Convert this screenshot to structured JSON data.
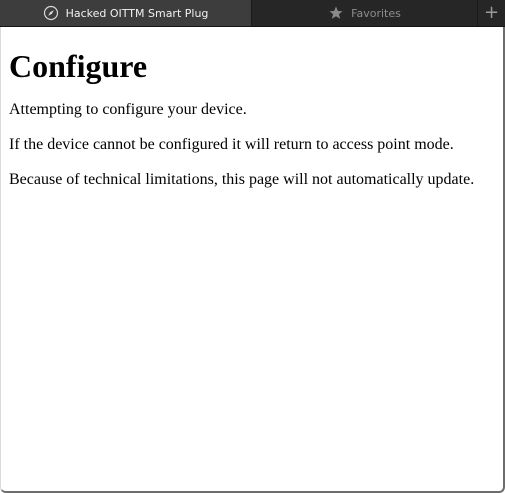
{
  "browser": {
    "tabs": [
      {
        "title": "Hacked OITTM Smart Plug",
        "icon": "compass-icon",
        "active": true
      },
      {
        "title": "Favorites",
        "icon": "star-icon",
        "active": false
      }
    ],
    "new_tab_label": "+"
  },
  "page": {
    "heading": "Configure",
    "paragraphs": [
      "Attempting to configure your device.",
      "If the device cannot be configured it will return to access point mode.",
      "Because of technical limitations, this page will not automatically update."
    ]
  },
  "colors": {
    "tabbar_background": "#2b2b2b",
    "active_tab_background": "#3d3d3d",
    "page_background": "#ffffff",
    "text": "#000000"
  }
}
